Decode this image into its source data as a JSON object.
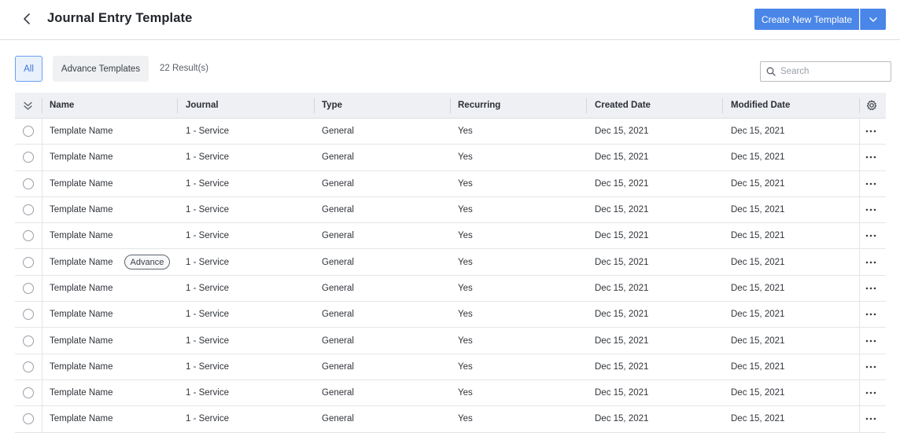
{
  "header": {
    "title": "Journal Entry Template",
    "create_label": "Create New Template"
  },
  "filters": {
    "all_label": "All",
    "advance_label": "Advance Templates",
    "result_count": "22 Result(s)"
  },
  "search": {
    "placeholder": "Search",
    "value": ""
  },
  "table": {
    "columns": [
      "Name",
      "Journal",
      "Type",
      "Recurring",
      "Created Date",
      "Modified Date"
    ],
    "rows": [
      {
        "name": "Template Name",
        "badge": "",
        "journal": "1 - Service",
        "type": "General",
        "recurring": "Yes",
        "created": "Dec 15, 2021",
        "modified": "Dec 15, 2021"
      },
      {
        "name": "Template Name",
        "badge": "",
        "journal": "1 - Service",
        "type": "General",
        "recurring": "Yes",
        "created": "Dec 15, 2021",
        "modified": "Dec 15, 2021"
      },
      {
        "name": "Template Name",
        "badge": "",
        "journal": "1 - Service",
        "type": "General",
        "recurring": "Yes",
        "created": "Dec 15, 2021",
        "modified": "Dec 15, 2021"
      },
      {
        "name": "Template Name",
        "badge": "",
        "journal": "1 - Service",
        "type": "General",
        "recurring": "Yes",
        "created": "Dec 15, 2021",
        "modified": "Dec 15, 2021"
      },
      {
        "name": "Template Name",
        "badge": "",
        "journal": "1 - Service",
        "type": "General",
        "recurring": "Yes",
        "created": "Dec 15, 2021",
        "modified": "Dec 15, 2021"
      },
      {
        "name": "Template Name",
        "badge": "Advance",
        "journal": "1 - Service",
        "type": "General",
        "recurring": "Yes",
        "created": "Dec 15, 2021",
        "modified": "Dec 15, 2021"
      },
      {
        "name": "Template Name",
        "badge": "",
        "journal": "1 - Service",
        "type": "General",
        "recurring": "Yes",
        "created": "Dec 15, 2021",
        "modified": "Dec 15, 2021"
      },
      {
        "name": "Template Name",
        "badge": "",
        "journal": "1 - Service",
        "type": "General",
        "recurring": "Yes",
        "created": "Dec 15, 2021",
        "modified": "Dec 15, 2021"
      },
      {
        "name": "Template Name",
        "badge": "",
        "journal": "1 - Service",
        "type": "General",
        "recurring": "Yes",
        "created": "Dec 15, 2021",
        "modified": "Dec 15, 2021"
      },
      {
        "name": "Template Name",
        "badge": "",
        "journal": "1 - Service",
        "type": "General",
        "recurring": "Yes",
        "created": "Dec 15, 2021",
        "modified": "Dec 15, 2021"
      },
      {
        "name": "Template Name",
        "badge": "",
        "journal": "1 - Service",
        "type": "General",
        "recurring": "Yes",
        "created": "Dec 15, 2021",
        "modified": "Dec 15, 2021"
      },
      {
        "name": "Template Name",
        "badge": "",
        "journal": "1 - Service",
        "type": "General",
        "recurring": "Yes",
        "created": "Dec 15, 2021",
        "modified": "Dec 15, 2021"
      }
    ]
  },
  "icons": {
    "back": "chevron-left-icon",
    "dropdown": "chevron-down-icon",
    "search": "search-icon",
    "expand": "double-chevron-down-icon",
    "settings": "gear-icon",
    "row_menu": "more-horizontal-icon"
  },
  "colors": {
    "primary": "#4a86e8",
    "active_filter_bg": "#e9f1fd",
    "table_header_bg": "#eef0f3"
  }
}
